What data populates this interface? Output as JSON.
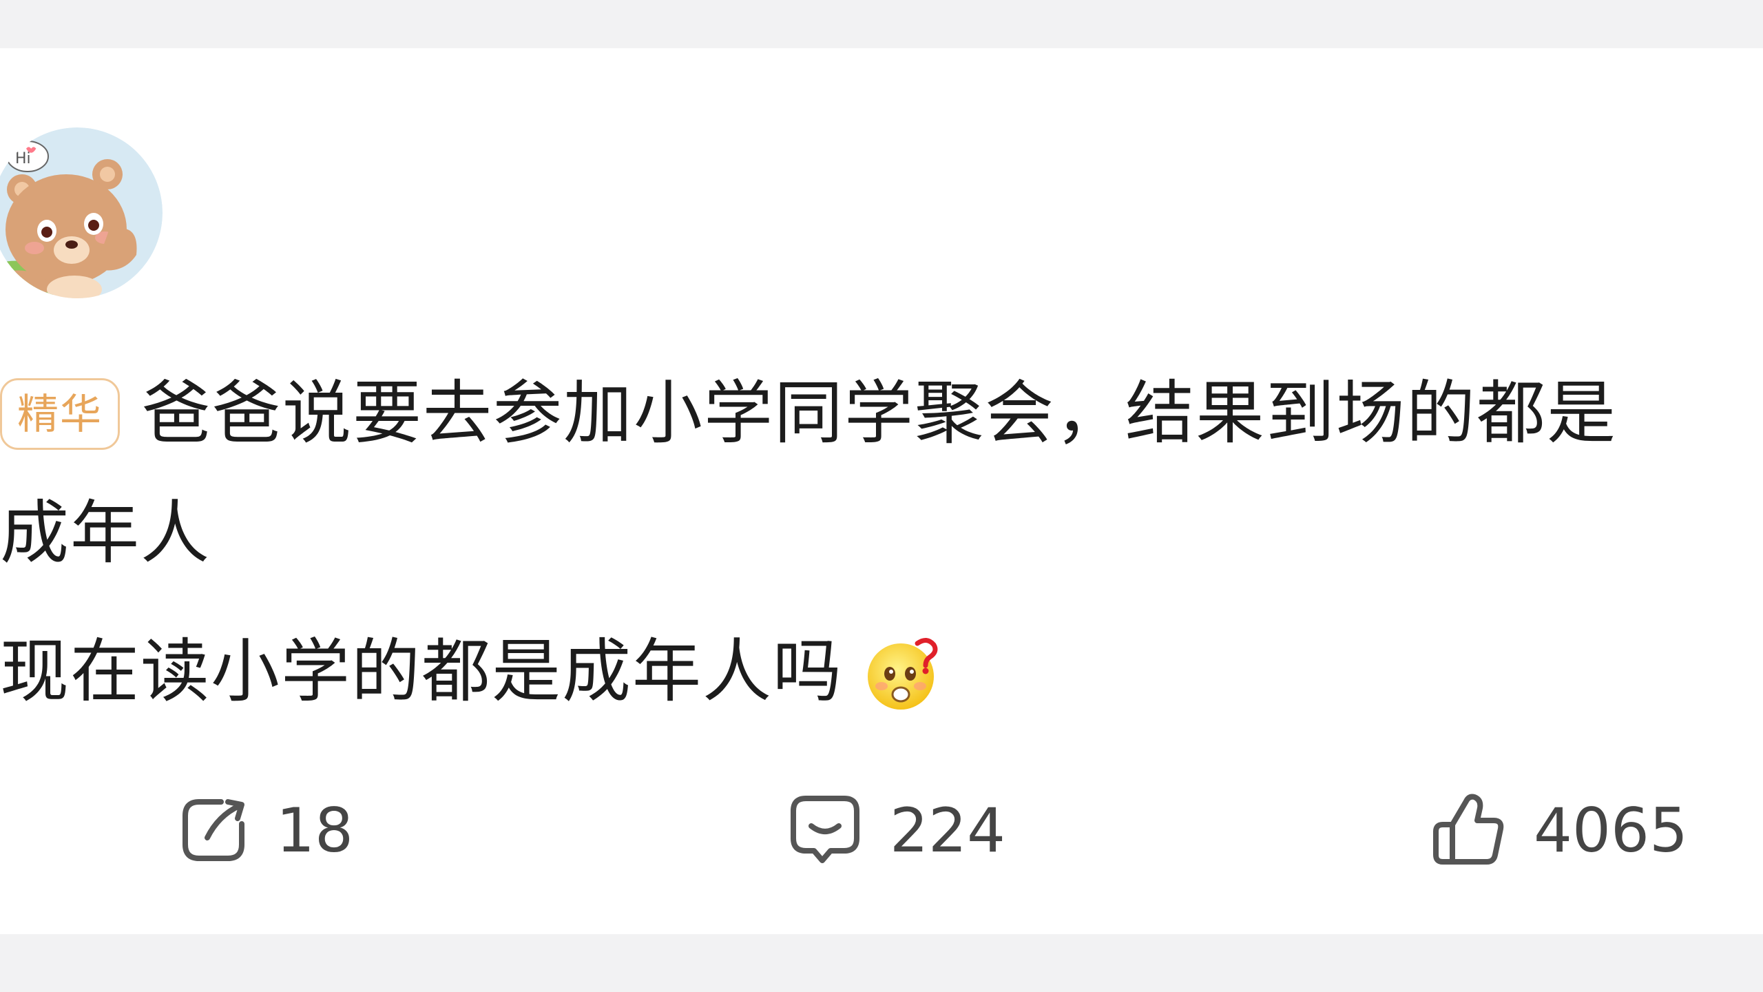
{
  "post": {
    "badge": "精华",
    "title_line1": "爸爸说要去参加小学同学聚会，结果到场的都是",
    "title_line2": "成年人",
    "body": "现在读小学的都是成年人吗",
    "emoji_icon": "thinking-question-emoji"
  },
  "avatar": {
    "icon": "bear-hi-avatar",
    "speech_text": "Hi"
  },
  "actions": {
    "share_count": "18",
    "comment_count": "224",
    "like_count": "4065"
  },
  "colors": {
    "background": "#f2f2f3",
    "card": "#ffffff",
    "badge_text": "#e7a55a",
    "badge_border": "#f0c899",
    "text": "#1c1c1c",
    "icon": "#555555"
  }
}
